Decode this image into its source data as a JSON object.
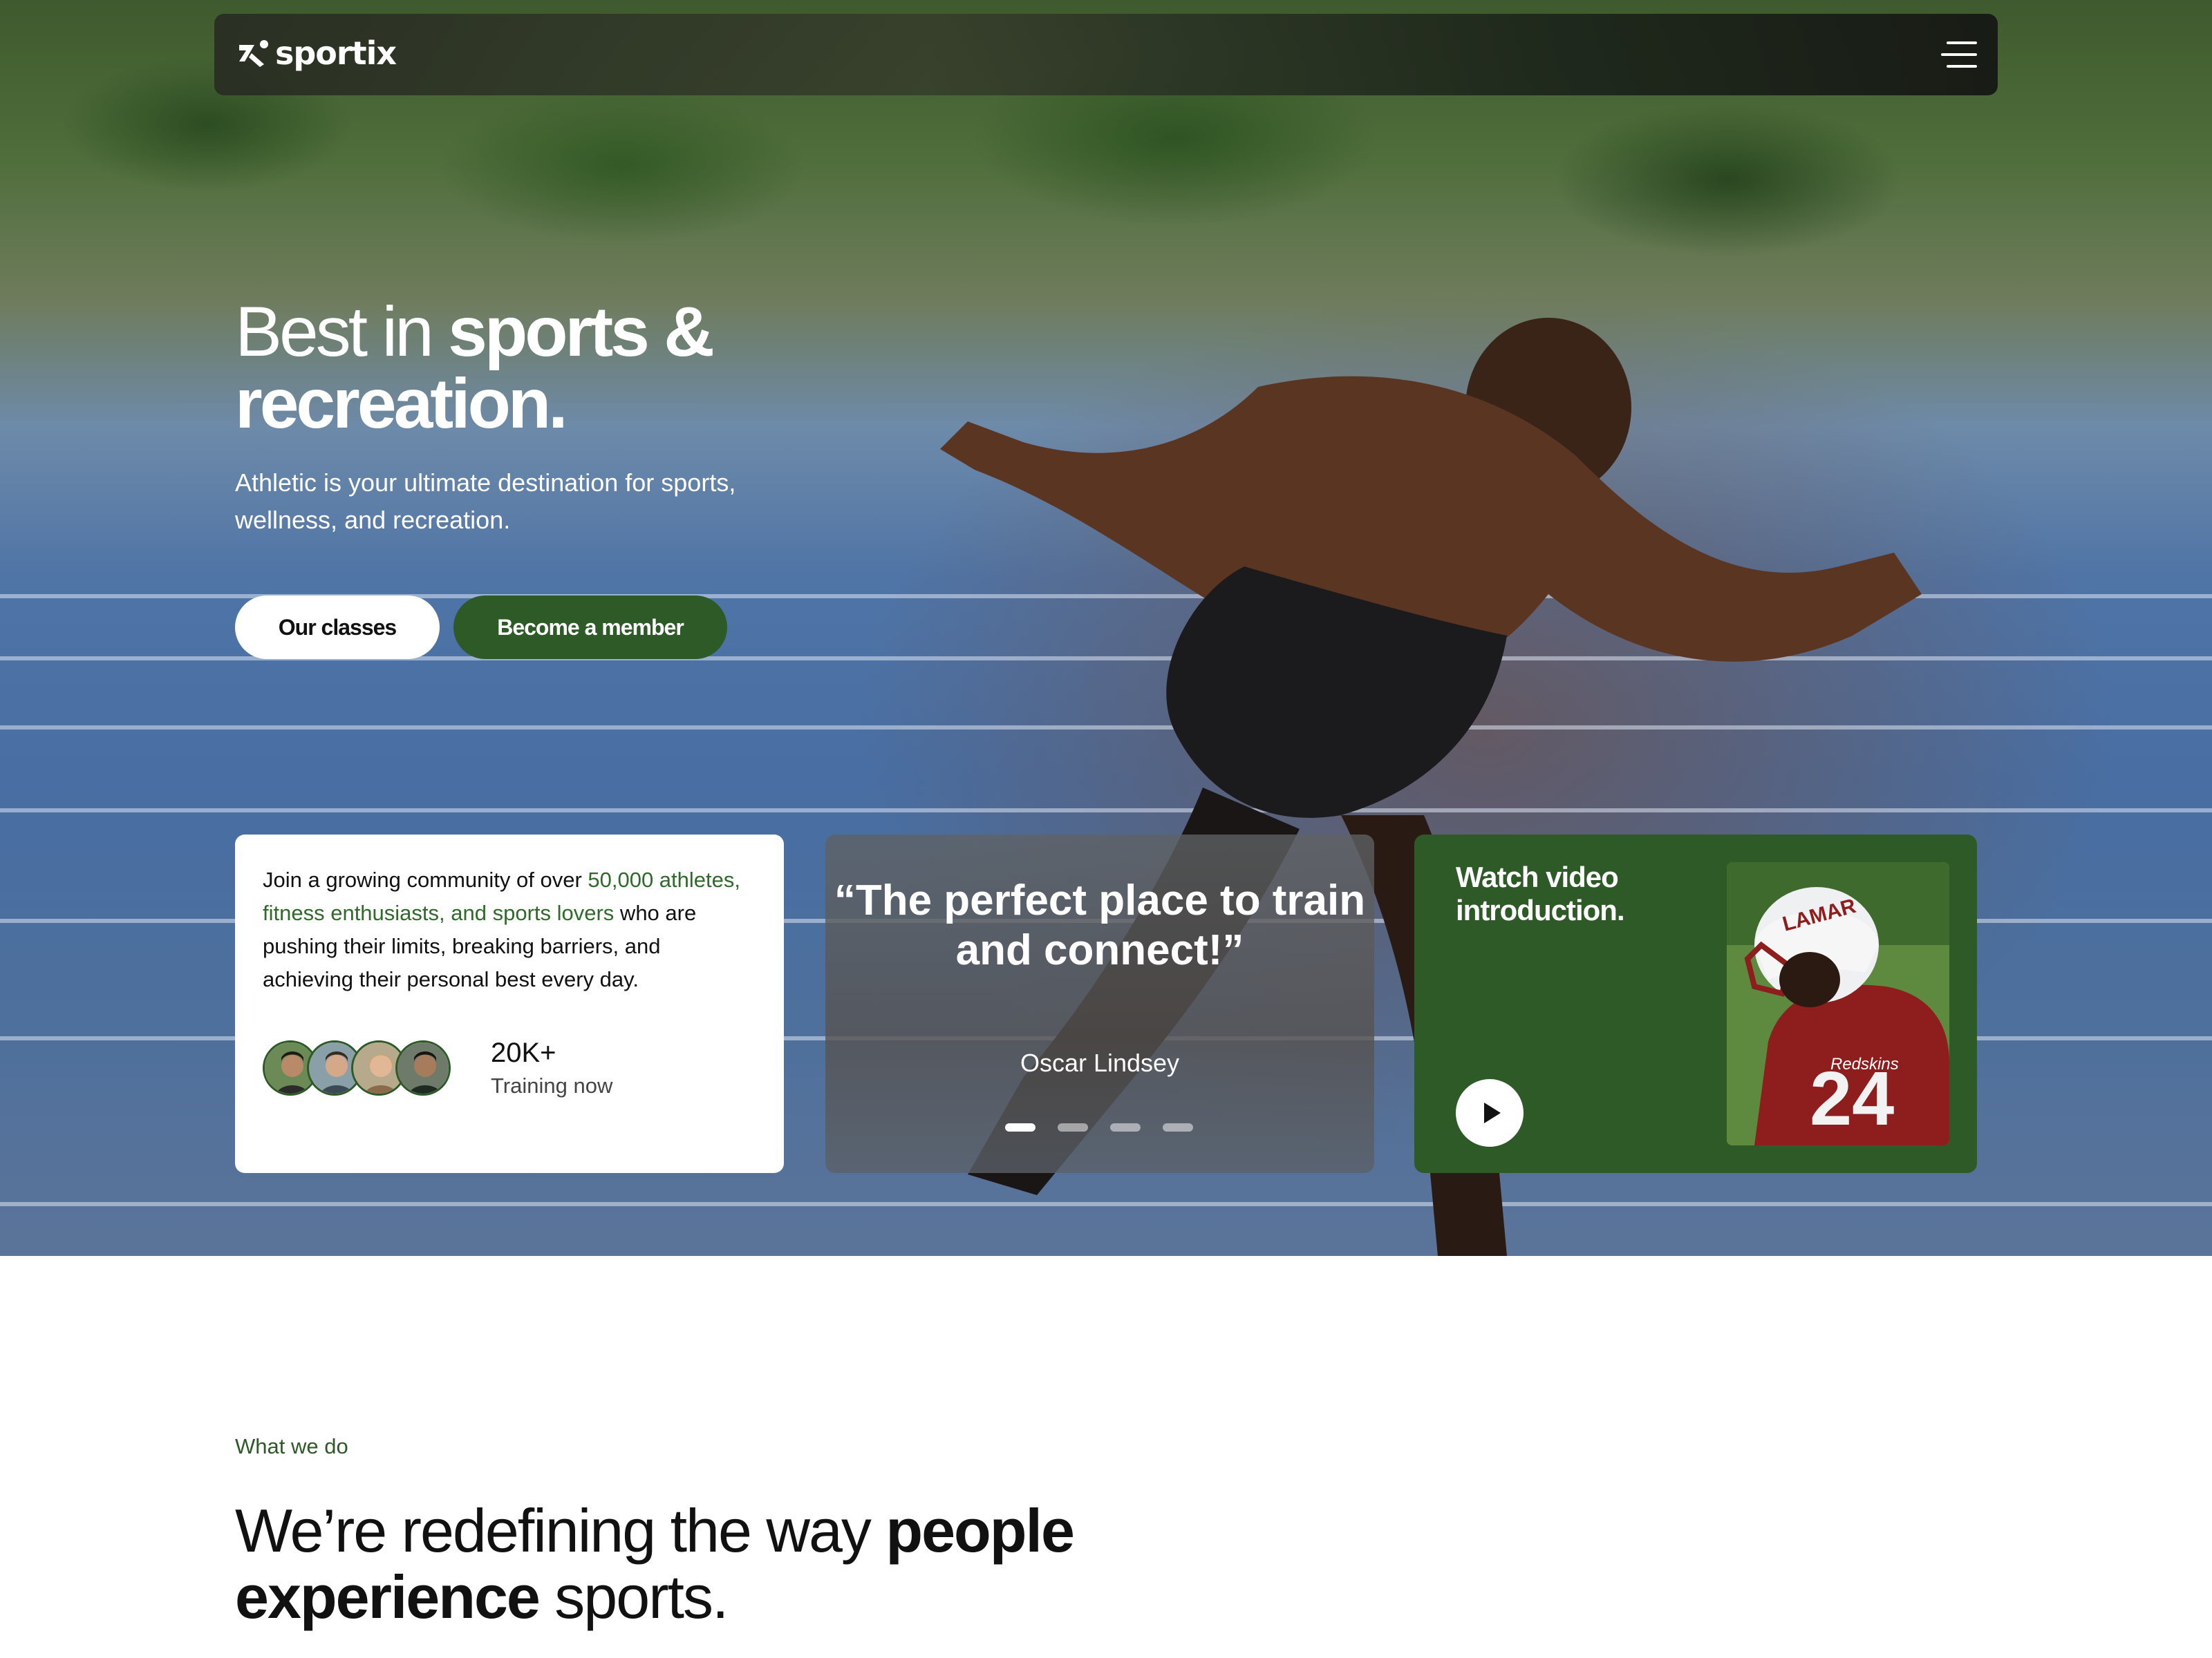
{
  "brand": {
    "name": "sportix"
  },
  "nav": {
    "menu_icon": "hamburger-menu-icon"
  },
  "hero": {
    "headline_light": "Best in ",
    "headline_bold_1": "sports &",
    "headline_bold_2": "recreation.",
    "subtext": "Athletic is your ultimate destination for sports, wellness, and recreation.",
    "primary_button": "Our classes",
    "secondary_button": "Become a member"
  },
  "community_card": {
    "text_before": "Join a growing community of over ",
    "text_highlight": "50,000 athletes, fitness enthusiasts, and sports lovers",
    "text_after": " who are pushing their limits, breaking barriers, and achieving their personal best every day.",
    "stat_value": "20K+",
    "stat_label": "Training now"
  },
  "quote_card": {
    "quote": "“The perfect place to train and connect!”",
    "author": "Oscar Lindsey",
    "slides": 4,
    "active_slide": 1
  },
  "video_card": {
    "title": "Watch video introduction.",
    "play_icon": "play-icon"
  },
  "section": {
    "eyebrow": "What we do",
    "title_part1": "We’re redefining the way ",
    "title_bold": "people experience",
    "title_part2": " sports."
  },
  "colors": {
    "accent_green": "#2d5a27",
    "highlight_green": "#2f6a2a",
    "white": "#ffffff"
  }
}
